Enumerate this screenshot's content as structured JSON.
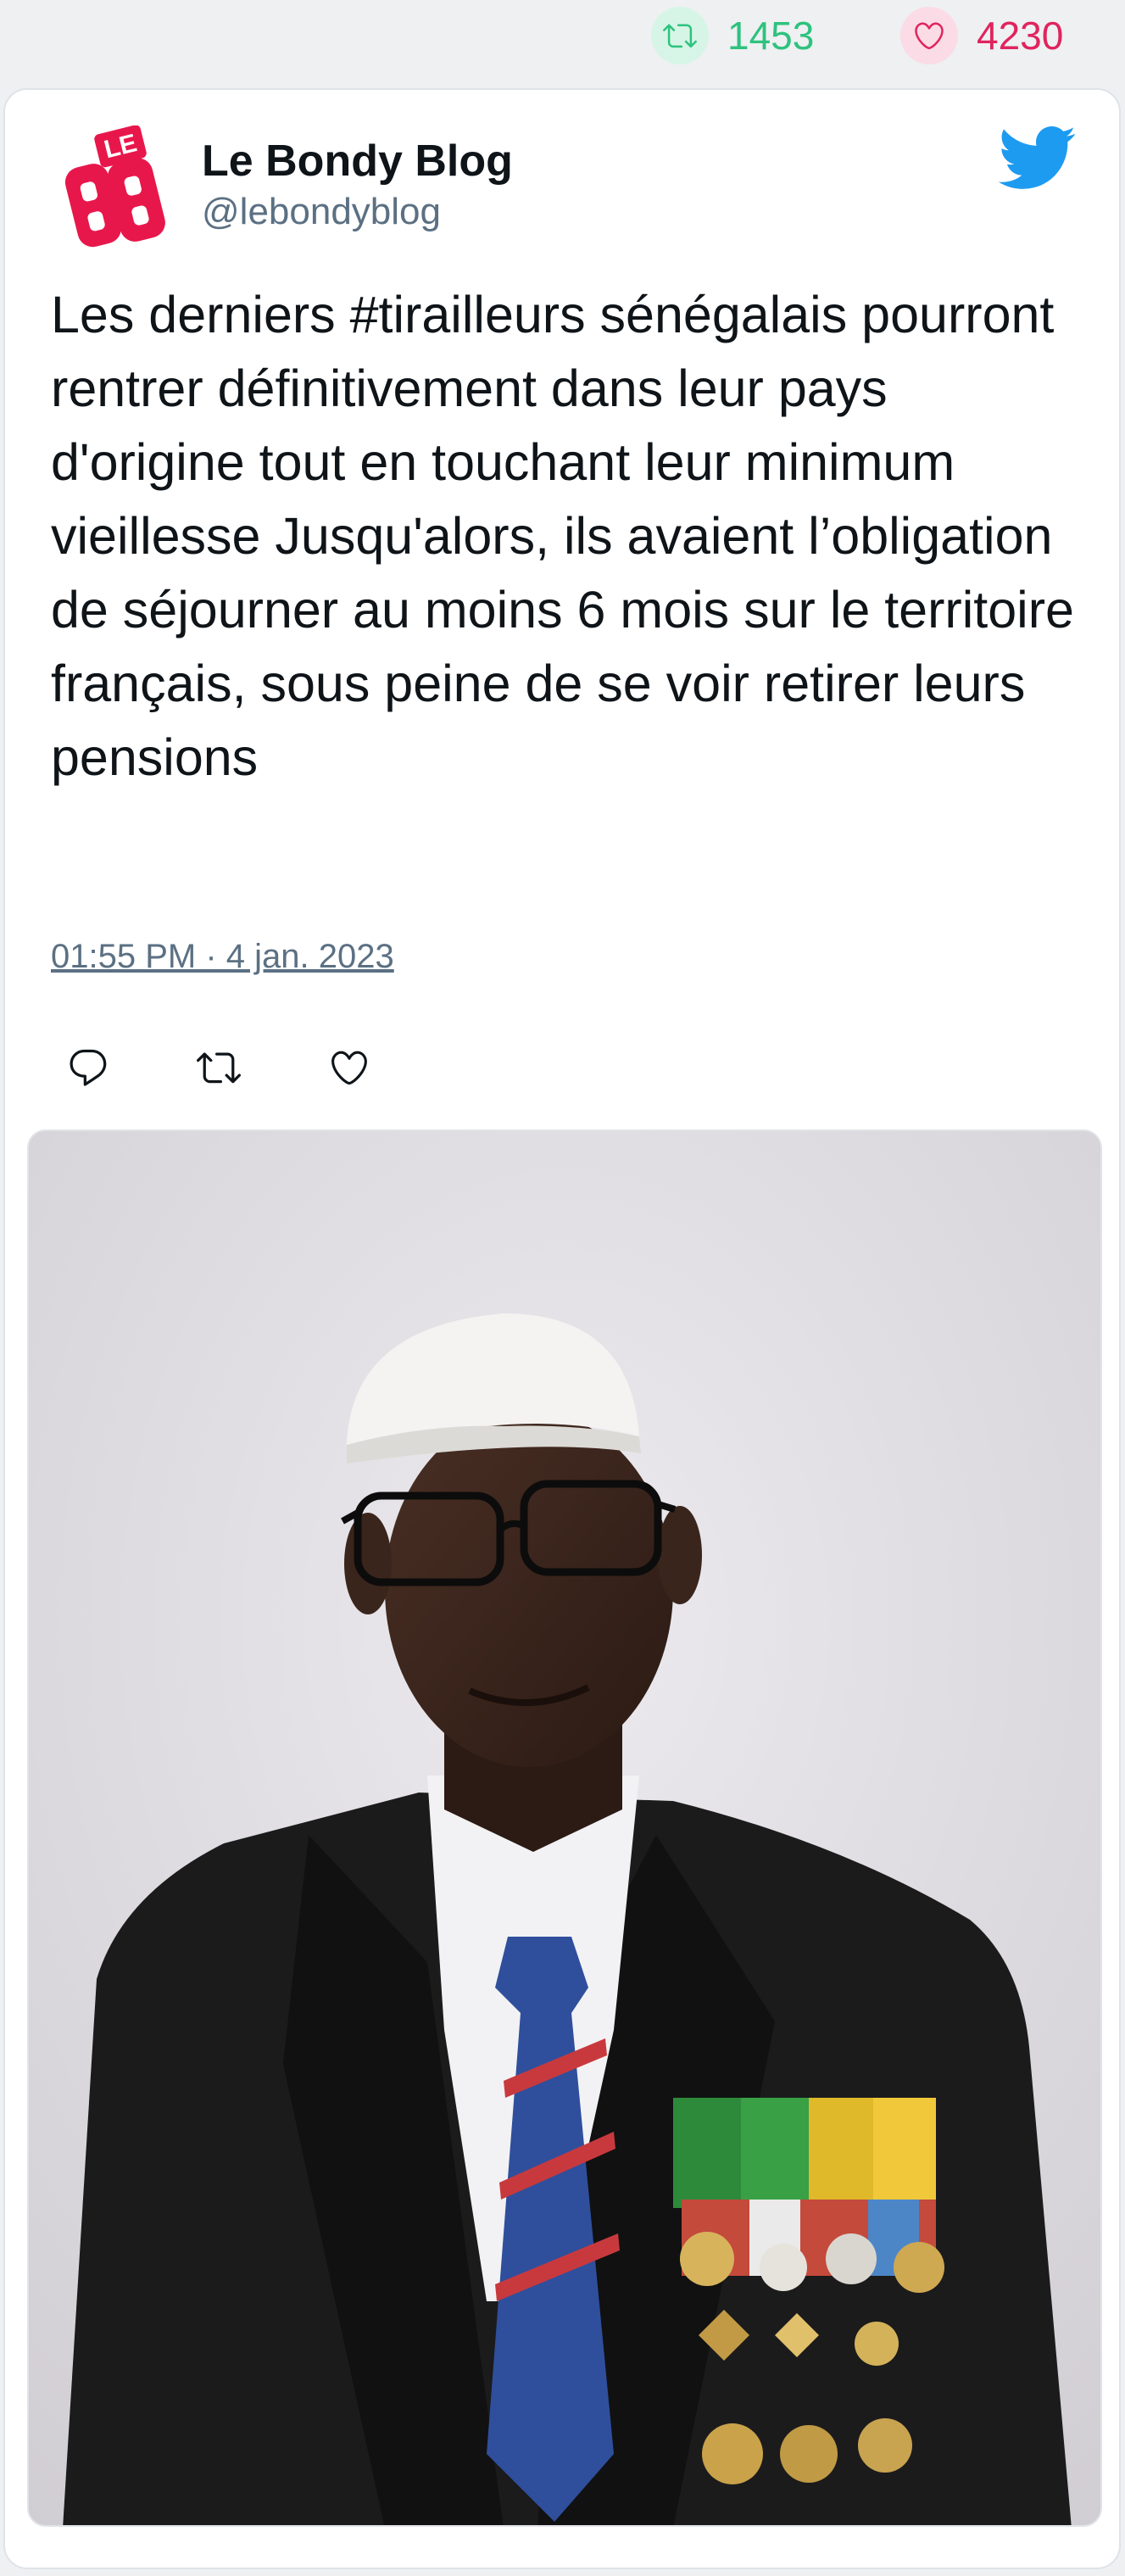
{
  "stats": {
    "retweets": "1453",
    "likes": "4230",
    "retweet_color": "#2ec27e",
    "like_color": "#e0245e"
  },
  "tweet": {
    "author_name": "Le Bondy Blog",
    "author_handle": "@lebondyblog",
    "avatar_logo_text": "LE BB",
    "text": "Les derniers #tirailleurs sénégalais pourront rentrer définitivement dans leur pays d'origine tout en touchant leur minimum vieillesse Jusqu'alors, ils avaient l’obligation de séjourner au moins 6 mois sur le territoire français, sous peine de se voir retirer leurs pensions",
    "timestamp": "01:55 PM · 4 jan. 2023"
  },
  "icons": {
    "platform": "twitter-bird-icon",
    "reply": "reply-icon",
    "retweet": "retweet-icon",
    "like": "heart-icon"
  },
  "colors": {
    "twitter_blue": "#1d9bf0",
    "logo_red": "#e8174b",
    "text": "#0f1419",
    "muted": "#5b7083"
  }
}
